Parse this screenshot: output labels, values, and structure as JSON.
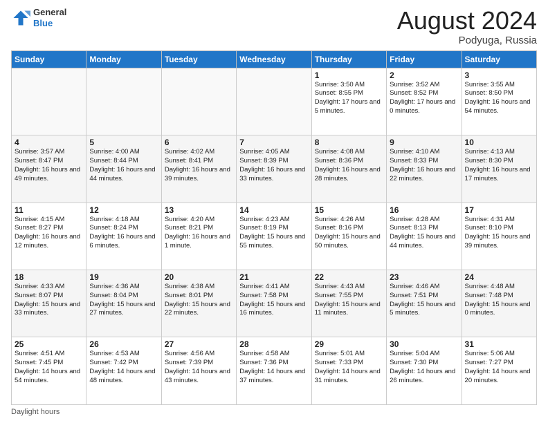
{
  "header": {
    "logo_general": "General",
    "logo_blue": "Blue",
    "month_title": "August 2024",
    "subtitle": "Podyuga, Russia"
  },
  "footer": {
    "daylight_hours": "Daylight hours"
  },
  "weekdays": [
    "Sunday",
    "Monday",
    "Tuesday",
    "Wednesday",
    "Thursday",
    "Friday",
    "Saturday"
  ],
  "weeks": [
    [
      {
        "day": "",
        "info": ""
      },
      {
        "day": "",
        "info": ""
      },
      {
        "day": "",
        "info": ""
      },
      {
        "day": "",
        "info": ""
      },
      {
        "day": "1",
        "info": "Sunrise: 3:50 AM\nSunset: 8:55 PM\nDaylight: 17 hours and 5 minutes."
      },
      {
        "day": "2",
        "info": "Sunrise: 3:52 AM\nSunset: 8:52 PM\nDaylight: 17 hours and 0 minutes."
      },
      {
        "day": "3",
        "info": "Sunrise: 3:55 AM\nSunset: 8:50 PM\nDaylight: 16 hours and 54 minutes."
      }
    ],
    [
      {
        "day": "4",
        "info": "Sunrise: 3:57 AM\nSunset: 8:47 PM\nDaylight: 16 hours and 49 minutes."
      },
      {
        "day": "5",
        "info": "Sunrise: 4:00 AM\nSunset: 8:44 PM\nDaylight: 16 hours and 44 minutes."
      },
      {
        "day": "6",
        "info": "Sunrise: 4:02 AM\nSunset: 8:41 PM\nDaylight: 16 hours and 39 minutes."
      },
      {
        "day": "7",
        "info": "Sunrise: 4:05 AM\nSunset: 8:39 PM\nDaylight: 16 hours and 33 minutes."
      },
      {
        "day": "8",
        "info": "Sunrise: 4:08 AM\nSunset: 8:36 PM\nDaylight: 16 hours and 28 minutes."
      },
      {
        "day": "9",
        "info": "Sunrise: 4:10 AM\nSunset: 8:33 PM\nDaylight: 16 hours and 22 minutes."
      },
      {
        "day": "10",
        "info": "Sunrise: 4:13 AM\nSunset: 8:30 PM\nDaylight: 16 hours and 17 minutes."
      }
    ],
    [
      {
        "day": "11",
        "info": "Sunrise: 4:15 AM\nSunset: 8:27 PM\nDaylight: 16 hours and 12 minutes."
      },
      {
        "day": "12",
        "info": "Sunrise: 4:18 AM\nSunset: 8:24 PM\nDaylight: 16 hours and 6 minutes."
      },
      {
        "day": "13",
        "info": "Sunrise: 4:20 AM\nSunset: 8:21 PM\nDaylight: 16 hours and 1 minute."
      },
      {
        "day": "14",
        "info": "Sunrise: 4:23 AM\nSunset: 8:19 PM\nDaylight: 15 hours and 55 minutes."
      },
      {
        "day": "15",
        "info": "Sunrise: 4:26 AM\nSunset: 8:16 PM\nDaylight: 15 hours and 50 minutes."
      },
      {
        "day": "16",
        "info": "Sunrise: 4:28 AM\nSunset: 8:13 PM\nDaylight: 15 hours and 44 minutes."
      },
      {
        "day": "17",
        "info": "Sunrise: 4:31 AM\nSunset: 8:10 PM\nDaylight: 15 hours and 39 minutes."
      }
    ],
    [
      {
        "day": "18",
        "info": "Sunrise: 4:33 AM\nSunset: 8:07 PM\nDaylight: 15 hours and 33 minutes."
      },
      {
        "day": "19",
        "info": "Sunrise: 4:36 AM\nSunset: 8:04 PM\nDaylight: 15 hours and 27 minutes."
      },
      {
        "day": "20",
        "info": "Sunrise: 4:38 AM\nSunset: 8:01 PM\nDaylight: 15 hours and 22 minutes."
      },
      {
        "day": "21",
        "info": "Sunrise: 4:41 AM\nSunset: 7:58 PM\nDaylight: 15 hours and 16 minutes."
      },
      {
        "day": "22",
        "info": "Sunrise: 4:43 AM\nSunset: 7:55 PM\nDaylight: 15 hours and 11 minutes."
      },
      {
        "day": "23",
        "info": "Sunrise: 4:46 AM\nSunset: 7:51 PM\nDaylight: 15 hours and 5 minutes."
      },
      {
        "day": "24",
        "info": "Sunrise: 4:48 AM\nSunset: 7:48 PM\nDaylight: 15 hours and 0 minutes."
      }
    ],
    [
      {
        "day": "25",
        "info": "Sunrise: 4:51 AM\nSunset: 7:45 PM\nDaylight: 14 hours and 54 minutes."
      },
      {
        "day": "26",
        "info": "Sunrise: 4:53 AM\nSunset: 7:42 PM\nDaylight: 14 hours and 48 minutes."
      },
      {
        "day": "27",
        "info": "Sunrise: 4:56 AM\nSunset: 7:39 PM\nDaylight: 14 hours and 43 minutes."
      },
      {
        "day": "28",
        "info": "Sunrise: 4:58 AM\nSunset: 7:36 PM\nDaylight: 14 hours and 37 minutes."
      },
      {
        "day": "29",
        "info": "Sunrise: 5:01 AM\nSunset: 7:33 PM\nDaylight: 14 hours and 31 minutes."
      },
      {
        "day": "30",
        "info": "Sunrise: 5:04 AM\nSunset: 7:30 PM\nDaylight: 14 hours and 26 minutes."
      },
      {
        "day": "31",
        "info": "Sunrise: 5:06 AM\nSunset: 7:27 PM\nDaylight: 14 hours and 20 minutes."
      }
    ]
  ]
}
